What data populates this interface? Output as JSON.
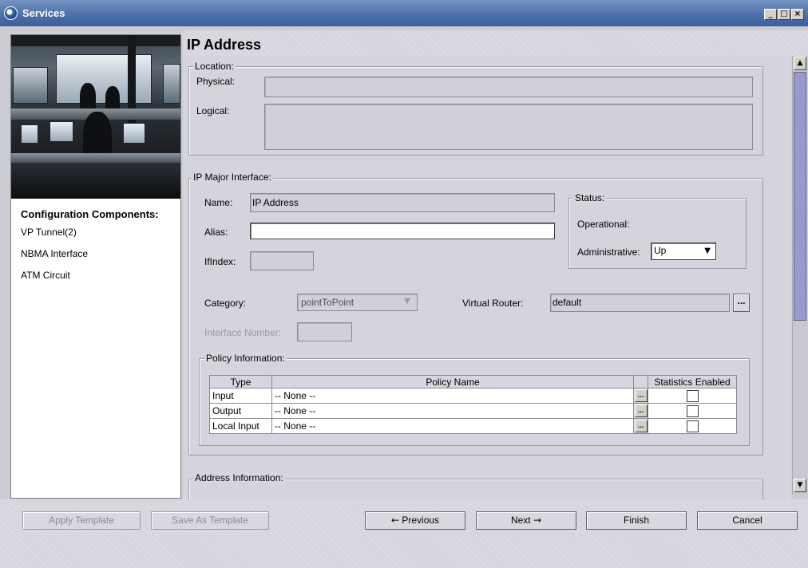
{
  "window": {
    "title": "Services",
    "controls": [
      "_",
      "□",
      "×"
    ]
  },
  "left": {
    "heading": "Configuration Components:",
    "items": [
      "VP Tunnel(2)",
      "NBMA Interface",
      "ATM Circuit"
    ]
  },
  "main": {
    "title": "IP Address",
    "location": {
      "legend": "Location:",
      "physical_label": "Physical:",
      "physical_value": "",
      "logical_label": "Logical:",
      "logical_value": ""
    },
    "major": {
      "legend": "IP Major Interface:",
      "name_label": "Name:",
      "name_value": "IP Address",
      "alias_label": "Alias:",
      "alias_value": "",
      "ifindex_label": "IfIndex:",
      "ifindex_value": "",
      "status": {
        "legend": "Status:",
        "operational_label": "Operational:",
        "administrative_label": "Administrative:",
        "administrative_value": "Up"
      },
      "category_label": "Category:",
      "category_value": "pointToPoint",
      "virtual_router_label": "Virtual Router:",
      "virtual_router_value": "default",
      "browse": "...",
      "interface_number_label": "Interface Number:",
      "interface_number_value": ""
    },
    "policy": {
      "legend": "Policy Information:",
      "headers": [
        "Type",
        "Policy Name",
        "",
        "Statistics Enabled"
      ],
      "rows": [
        {
          "type": "Input",
          "name": "-- None --",
          "stats": false
        },
        {
          "type": "Output",
          "name": "-- None --",
          "stats": false
        },
        {
          "type": "Local Input",
          "name": "-- None --",
          "stats": false
        }
      ]
    },
    "address": {
      "legend": "Address Information:"
    }
  },
  "buttons": {
    "apply_template": "Apply Template",
    "save_as_template": "Save As Template",
    "previous": "Previous",
    "next": "Next",
    "finish": "Finish",
    "cancel": "Cancel"
  },
  "colors": {
    "titlebar": "#4a6ea8",
    "scroll_thumb": "#9090c8",
    "background": "#d6d6de"
  },
  "icons": {
    "app": "services-globe-icon",
    "previous": "arrow-left-icon",
    "next": "arrow-right-icon",
    "dropdown": "chevron-down-icon"
  }
}
